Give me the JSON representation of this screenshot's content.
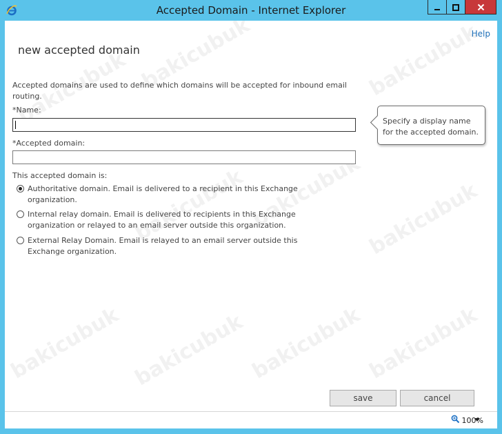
{
  "window": {
    "title": "Accepted Domain - Internet Explorer",
    "minimize_icon": "minimize-icon",
    "maximize_icon": "maximize-icon",
    "close_icon": "close-icon"
  },
  "header": {
    "help": "Help",
    "page_title": "new accepted domain"
  },
  "form": {
    "description": "Accepted domains are used to define which domains will be accepted for inbound email routing.",
    "name_label": "*Name:",
    "name_value": "",
    "domain_label": "*Accepted domain:",
    "domain_value": "",
    "type_label": "This accepted domain is:",
    "options": [
      {
        "label": "Authoritative domain. Email is delivered to a recipient in this Exchange organization.",
        "selected": true
      },
      {
        "label": "Internal relay domain. Email is delivered to recipients in this Exchange organization or relayed to an email server outside this organization.",
        "selected": false
      },
      {
        "label": "External Relay Domain. Email is relayed to an email server outside this Exchange organization.",
        "selected": false
      }
    ]
  },
  "tooltip": {
    "text": "Specify a display name for the accepted domain."
  },
  "actions": {
    "save": "save",
    "cancel": "cancel"
  },
  "statusbar": {
    "zoom": "100%",
    "zoom_icon": "zoom-icon"
  },
  "watermark": "bakicubuk",
  "colors": {
    "frame": "#5ac3ea",
    "close_button": "#c7383a",
    "link": "#1e6fb8"
  }
}
